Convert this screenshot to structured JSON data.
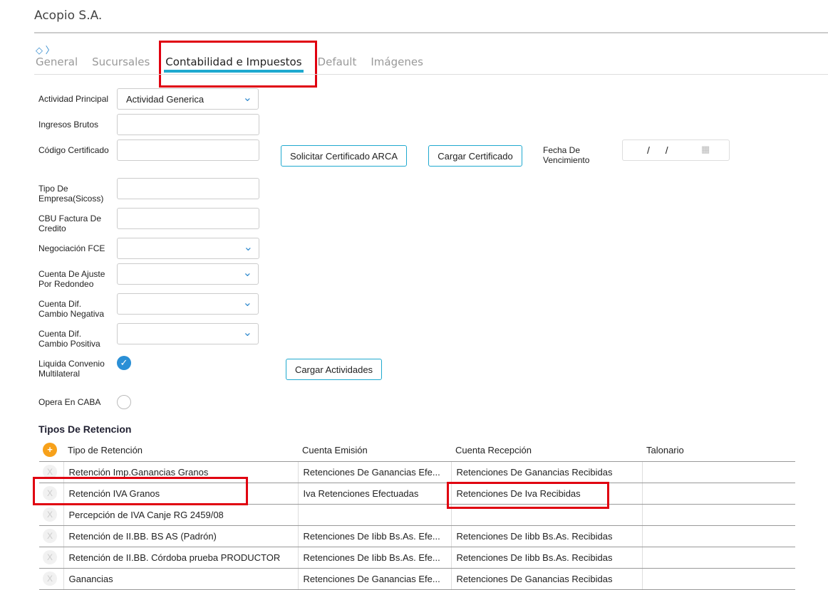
{
  "title": "Acopio S.A.",
  "tabs": [
    "General",
    "Sucursales",
    "Contabilidad e Impuestos",
    "Default",
    "Imágenes"
  ],
  "form": {
    "actividad_principal": {
      "label": "Actividad Principal",
      "value": "Actividad Generica"
    },
    "ingresos_brutos": {
      "label": "Ingresos Brutos"
    },
    "codigo_certificado": {
      "label": "Código Certificado"
    },
    "tipo_empresa": {
      "label": "Tipo De Empresa(Sicoss)"
    },
    "cbu": {
      "label": "CBU Factura De Credito"
    },
    "negociacion": {
      "label": "Negociación FCE"
    },
    "ajuste": {
      "label": "Cuenta De Ajuste Por Redondeo"
    },
    "dif_neg": {
      "label": "Cuenta Dif. Cambio Negativa"
    },
    "dif_pos": {
      "label": "Cuenta Dif. Cambio Positiva"
    },
    "convenio": {
      "label": "Liquida Convenio Multilateral",
      "checked": true
    },
    "caba": {
      "label": "Opera En CABA",
      "checked": false
    },
    "fecha": {
      "label": "Fecha De Vencimiento",
      "value": "/ /"
    }
  },
  "buttons": {
    "solicitar": "Solicitar Certificado ARCA",
    "cargar_cert": "Cargar Certificado",
    "cargar_act": "Cargar Actividades"
  },
  "retencion": {
    "title": "Tipos De Retencion",
    "delete_label": "X",
    "headers": [
      "Tipo de Retención",
      "Cuenta Emisión",
      "Cuenta Recepción",
      "Talonario"
    ],
    "rows": [
      [
        "Retención Imp.Ganancias Granos",
        "Retenciones De Ganancias Efe...",
        "Retenciones De Ganancias Recibidas",
        ""
      ],
      [
        "Retención IVA Granos",
        "Iva Retenciones Efectuadas",
        "Retenciones De Iva Recibidas",
        ""
      ],
      [
        "Percepción de IVA Canje RG 2459/08",
        "",
        "",
        ""
      ],
      [
        "Retención de II.BB. BS AS (Padrón)",
        "Retenciones De Iibb Bs.As. Efe...",
        "Retenciones De Iibb Bs.As. Recibidas",
        ""
      ],
      [
        "Retención de II.BB. Córdoba prueba PRODUCTOR",
        "Retenciones De Iibb Bs.As. Efe...",
        "Retenciones De Iibb Bs.As. Recibidas",
        ""
      ],
      [
        "Ganancias",
        "Retenciones De Ganancias Efe...",
        "Retenciones De Ganancias Recibidas",
        ""
      ]
    ]
  }
}
